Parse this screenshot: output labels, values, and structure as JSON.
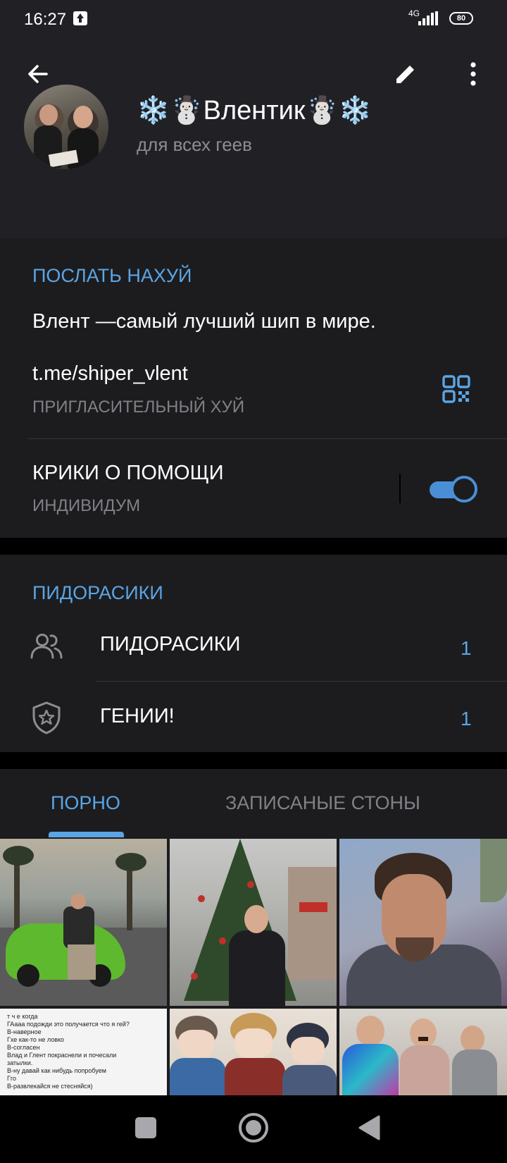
{
  "status_bar": {
    "time": "16:27",
    "network": "4G",
    "battery": "80",
    "upload_icon": "upload-arrow-icon",
    "signal_icon": "signal-bars-icon"
  },
  "toolbar": {
    "back_icon": "arrow-left-icon",
    "edit_icon": "pencil-icon",
    "more_icon": "more-vertical-icon"
  },
  "profile": {
    "name": "Влентик",
    "name_decor_left": "❄️☃️",
    "name_decor_right": "☃️❄️",
    "subtitle": "для всех геев"
  },
  "info": {
    "section_title": "ПОСЛАТЬ НАХУЙ",
    "description": "Влент —самый лучший шип в мире.",
    "link": "t.me/shiper_vlent",
    "link_label": "ПРИГЛАСИТЕЛЬНЫЙ ХУЙ",
    "qr_icon": "qr-code-icon",
    "toggle_title": "КРИКИ О ПОМОЩИ",
    "toggle_subtitle": "ИНДИВИДУМ",
    "toggle_on": true
  },
  "groups": {
    "section_title": "ПИДОРАСИКИ",
    "items": [
      {
        "icon": "users-icon",
        "label": "ПИДОРАСИКИ",
        "count": "1"
      },
      {
        "icon": "shield-star-icon",
        "label": "ГЕНИИ!",
        "count": "1"
      }
    ]
  },
  "media": {
    "tabs": [
      {
        "label": "ПОРНО",
        "active": true
      },
      {
        "label": "ЗАПИСАНЫЕ СТОНЫ",
        "active": false
      }
    ],
    "note_lines": [
      "т ч е когда",
      "ГАааа подожди это получается что я гей?",
      "В-наверное",
      "Гхе как-то не ловко",
      "В-согласен",
      "Влад и Глент покраснели и почесали",
      "затылки.",
      "В-ну давай как нибудь попробуем",
      "Гго",
      "В-развлекайся не стесняйся)"
    ]
  },
  "navbar": {
    "recents_icon": "square-icon",
    "home_icon": "circle-home-icon",
    "back_icon": "triangle-back-icon"
  },
  "colors": {
    "header_bg": "#212125",
    "section_bg": "#1c1c1f",
    "accent": "#5ba5e4",
    "secondary_text": "#808086"
  }
}
